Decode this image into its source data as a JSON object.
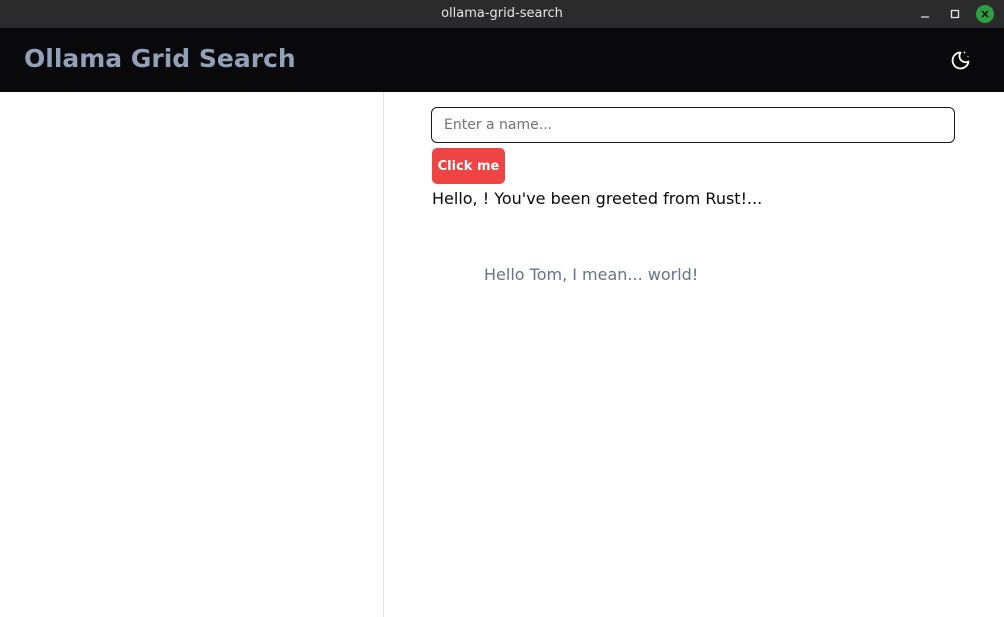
{
  "window": {
    "title": "ollama-grid-search",
    "controls": {
      "minimize_icon": "minimize-icon",
      "maximize_icon": "maximize-icon",
      "close_icon": "close-icon",
      "close_color": "#2ea043"
    }
  },
  "header": {
    "title": "Ollama Grid Search",
    "theme_toggle_icon": "moon-stars-icon",
    "background": "#09090b",
    "title_color": "#93a1b8"
  },
  "main": {
    "name_input": {
      "value": "",
      "placeholder": "Enter a name..."
    },
    "submit_button": {
      "label": "Click me",
      "color": "#ef4444"
    },
    "greet_message": "Hello, ! You've been greeted from Rust!...",
    "hello_message": "Hello Tom, I mean... world!"
  }
}
